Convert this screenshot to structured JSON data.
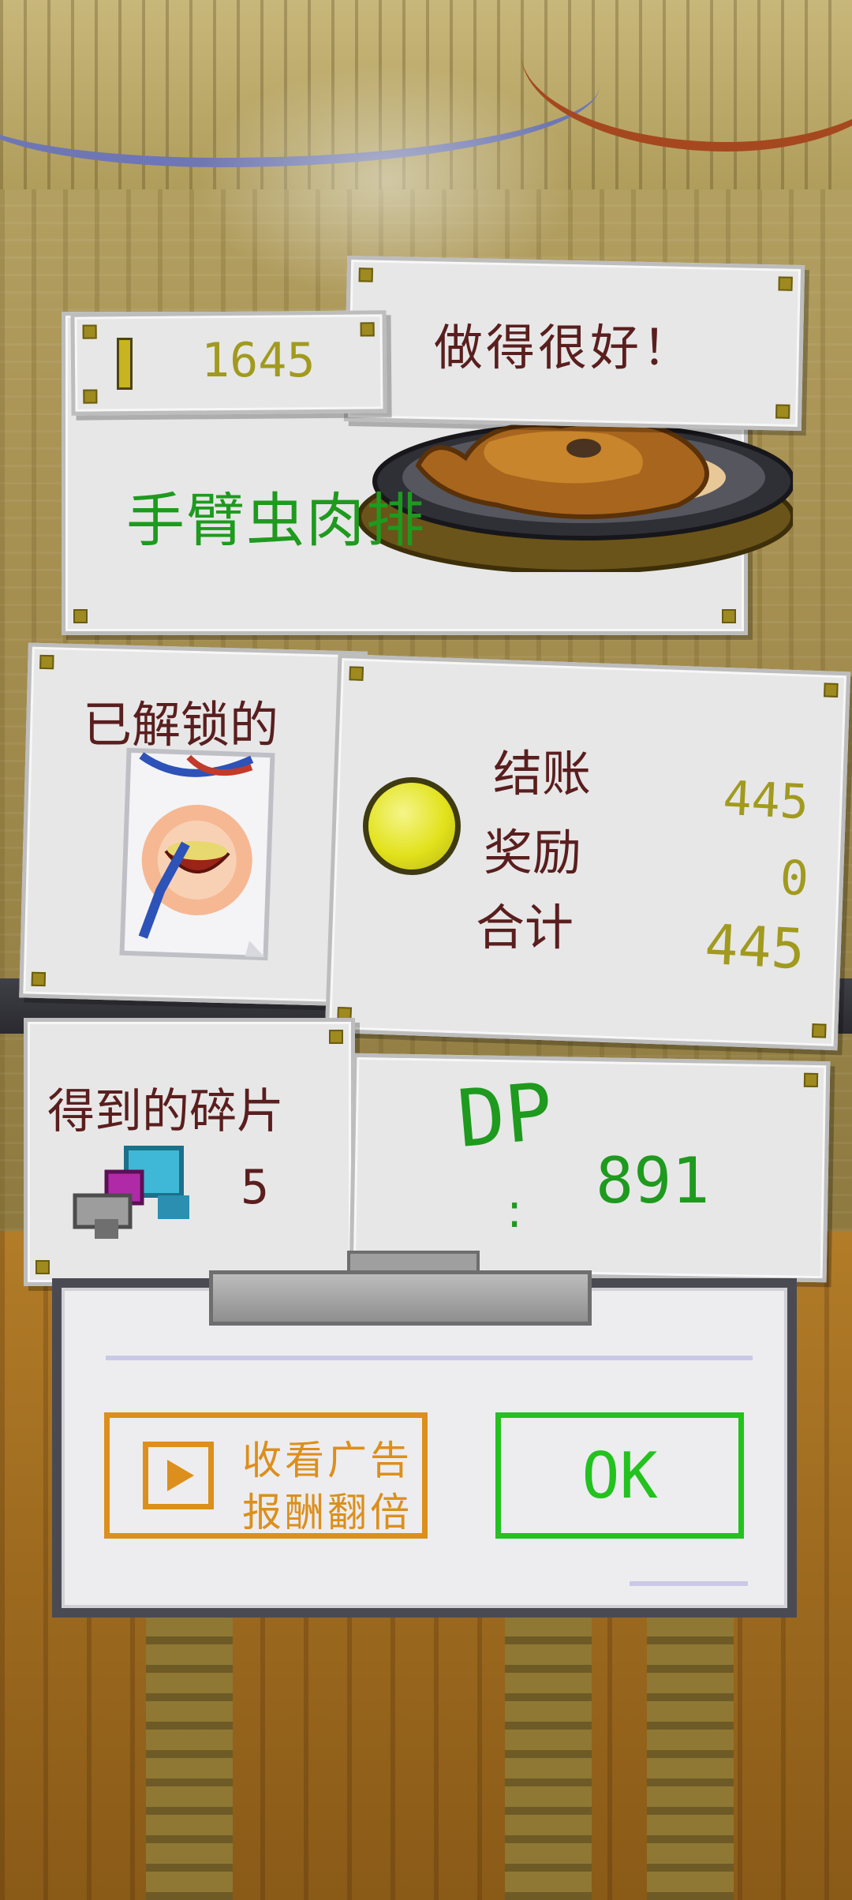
{
  "result": {
    "praise": "做得很好！",
    "gold": "1645",
    "dish_name": "手臂虫肉排"
  },
  "unlocked": {
    "label": "已解锁的"
  },
  "payment": {
    "rows": [
      {
        "label": "结账",
        "value": "445"
      },
      {
        "label": "奖励",
        "value": "0"
      },
      {
        "label": "合计",
        "value": "445"
      }
    ]
  },
  "shards": {
    "label": "得到的碎片",
    "count": "5"
  },
  "dp": {
    "label": "DP",
    "colon": ":",
    "value": "891"
  },
  "dialog": {
    "ad_line1": "收看广告",
    "ad_line2": "报酬翻倍",
    "ok_label": "OK"
  },
  "colors": {
    "accent_green": "#23c21e",
    "accent_orange": "#dc8f1c",
    "text_brown": "#5a1e1e",
    "gold_yellow": "#a19a1e"
  }
}
